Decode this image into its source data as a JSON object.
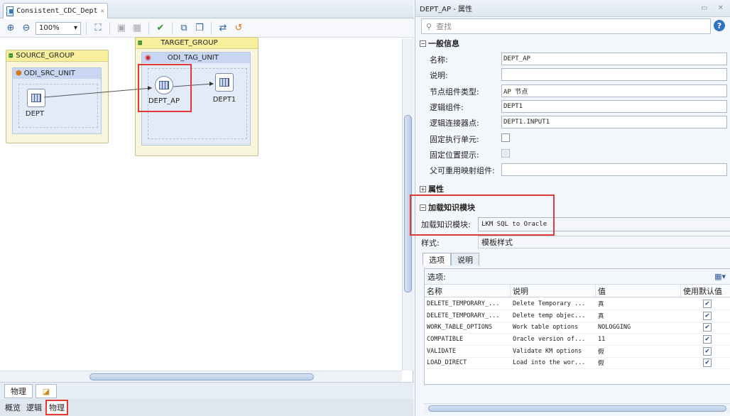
{
  "editor": {
    "tab_title": "Consistent_CDC_Dept",
    "zoom": "100%",
    "groups": {
      "source": {
        "title": "SOURCE_GROUP",
        "unit": "ODI_SRC_UNIT",
        "node": "DEPT"
      },
      "target": {
        "title": "TARGET_GROUP",
        "unit": "ODI_TAG_UNIT",
        "node_ap": "DEPT_AP",
        "node_target": "DEPT1"
      }
    },
    "bottom_tabs": {
      "physical": "物理"
    },
    "view_tabs": [
      "概览",
      "逻辑",
      "物理"
    ]
  },
  "properties": {
    "title": "DEPT_AP - 属性",
    "search_placeholder": "查找",
    "help": "?",
    "general": {
      "section": "一般信息",
      "rows": [
        {
          "label": "名称:",
          "value": "DEPT_AP"
        },
        {
          "label": "说明:",
          "value": ""
        },
        {
          "label": "节点组件类型:",
          "value": "AP 节点"
        },
        {
          "label": "逻辑组件:",
          "value": "DEPT1"
        },
        {
          "label": "逻辑连接器点:",
          "value": "DEPT1.INPUT1"
        }
      ],
      "fixed_unit_label": "固定执行单元:",
      "fixed_location_label": "固定位置提示:",
      "parent_mapping_label": "父可重用映射组件:"
    },
    "attributes_section": "属性",
    "lkm": {
      "section": "加载知识模块",
      "label": "加载知识模块:",
      "value": "LKM SQL to Oracle",
      "style_label": "样式:",
      "style_value": "模板样式"
    },
    "subtabs": [
      "选项",
      "说明"
    ],
    "options": {
      "title": "选项:",
      "columns": [
        "名称",
        "说明",
        "值",
        "使用默认值"
      ],
      "rows": [
        {
          "name": "DELETE_TEMPORARY_...",
          "desc": "Delete Temporary ...",
          "value": "真",
          "default": true
        },
        {
          "name": "DELETE_TEMPORARY_...",
          "desc": "Delete temp objec...",
          "value": "真",
          "default": true
        },
        {
          "name": "WORK_TABLE_OPTIONS",
          "desc": "Work table options",
          "value": "NOLOGGING",
          "default": true
        },
        {
          "name": "COMPATIBLE",
          "desc": "Oracle version of...",
          "value": "11",
          "default": true
        },
        {
          "name": "VALIDATE",
          "desc": "Validate KM options",
          "value": "假",
          "default": true
        },
        {
          "name": "LOAD_DIRECT",
          "desc": "Load into the wor...",
          "value": "假",
          "default": true
        }
      ]
    }
  },
  "colors": {
    "highlight": "#e13838",
    "group_bg": "#f8f6dc",
    "unit_bg": "#e4ebf8"
  }
}
